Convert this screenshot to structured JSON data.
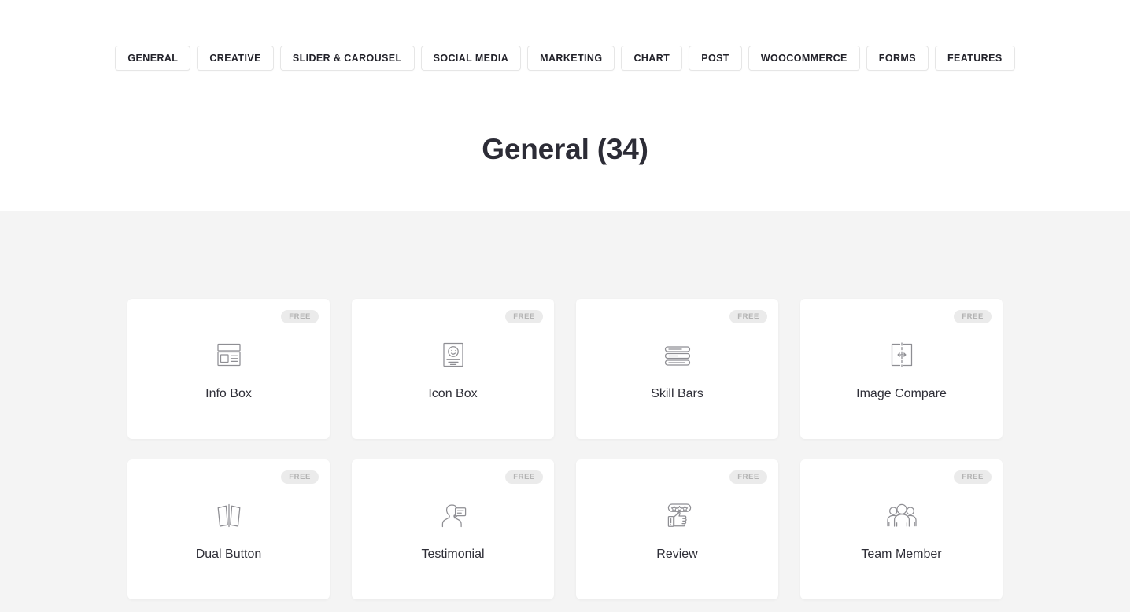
{
  "filters": [
    {
      "label": "GENERAL",
      "name": "general"
    },
    {
      "label": "CREATIVE",
      "name": "creative"
    },
    {
      "label": "SLIDER & CAROUSEL",
      "name": "slider-carousel"
    },
    {
      "label": "SOCIAL MEDIA",
      "name": "social-media"
    },
    {
      "label": "MARKETING",
      "name": "marketing"
    },
    {
      "label": "CHART",
      "name": "chart"
    },
    {
      "label": "POST",
      "name": "post"
    },
    {
      "label": "WOOCOMMERCE",
      "name": "woocommerce"
    },
    {
      "label": "FORMS",
      "name": "forms"
    },
    {
      "label": "FEATURES",
      "name": "features"
    }
  ],
  "heading": {
    "title": "General (34)",
    "category": "General",
    "count": 34
  },
  "widgets": [
    {
      "label": "Info Box",
      "badge": "FREE",
      "icon": "info-box-icon"
    },
    {
      "label": "Icon Box",
      "badge": "FREE",
      "icon": "icon-box-icon"
    },
    {
      "label": "Skill Bars",
      "badge": "FREE",
      "icon": "skill-bars-icon"
    },
    {
      "label": "Image Compare",
      "badge": "FREE",
      "icon": "image-compare-icon"
    },
    {
      "label": "Dual Button",
      "badge": "FREE",
      "icon": "dual-button-icon"
    },
    {
      "label": "Testimonial",
      "badge": "FREE",
      "icon": "testimonial-icon"
    },
    {
      "label": "Review",
      "badge": "FREE",
      "icon": "review-icon"
    },
    {
      "label": "Team Member",
      "badge": "FREE",
      "icon": "team-member-icon"
    }
  ],
  "colors": {
    "page_background": "#ffffff",
    "section_background": "#f4f4f4",
    "card_background": "#ffffff",
    "badge_background": "#ebebeb",
    "badge_text": "#b3b3b3",
    "icon_stroke": "#8e8e93",
    "title_text": "#2c2c36",
    "button_border": "#e6e6e6"
  }
}
